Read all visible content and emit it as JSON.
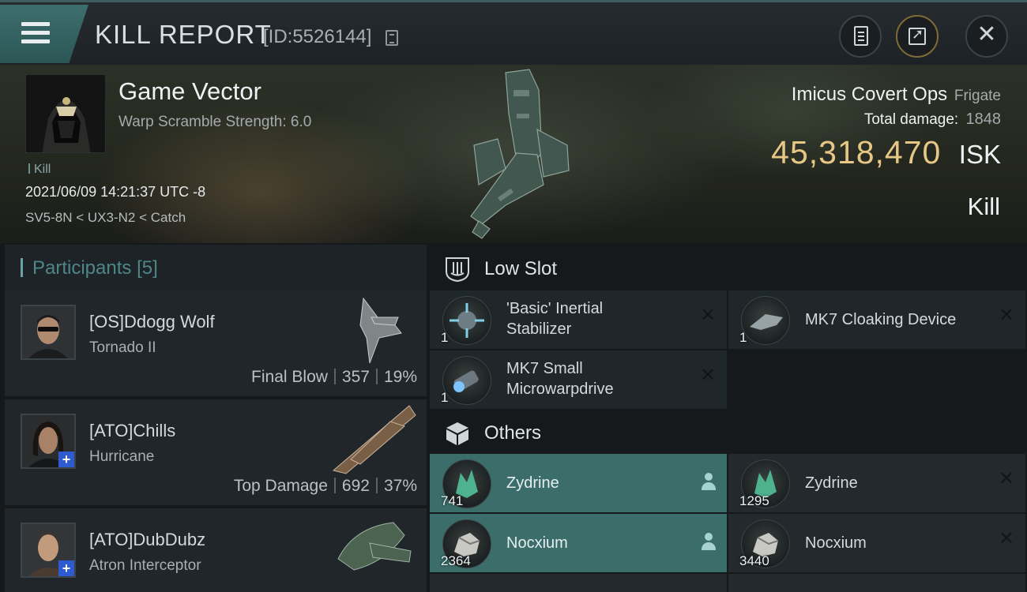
{
  "header": {
    "title": "KILL REPORT",
    "id_text": "[ID:5526144]"
  },
  "victim": {
    "name": "Game Vector",
    "subtitle": "Warp Scramble Strength: 6.0",
    "tag": "Kill",
    "timestamp": "2021/06/09 14:21:37 UTC -8",
    "location": "SV5-8N < UX3-N2 < Catch"
  },
  "ship": {
    "name": "Imicus Covert Ops",
    "class": "Frigate",
    "total_damage_label": "Total damage:",
    "total_damage": "1848",
    "isk_value": "45,318,470",
    "isk_unit": "ISK",
    "result": "Kill"
  },
  "participants": {
    "title": "Participants",
    "count": "[5]",
    "rows": [
      {
        "name": "[OS]Ddogg Wolf",
        "ship": "Tornado II",
        "role": "Final Blow",
        "damage": "357",
        "percent": "19%"
      },
      {
        "name": "[ATO]Chills",
        "ship": "Hurricane",
        "role": "Top Damage",
        "damage": "692",
        "percent": "37%"
      },
      {
        "name": "[ATO]DubDubz",
        "ship": "Atron Interceptor"
      }
    ]
  },
  "sections": {
    "low_slot": "Low Slot",
    "others": "Others"
  },
  "low_slot_items": [
    {
      "name_line1": "'Basic' Inertial",
      "name_line2": "Stabilizer",
      "qty": "1",
      "status_icon": "destroyed-x-icon"
    },
    {
      "name_line1": "MK7 Cloaking Device",
      "name_line2": "",
      "qty": "1",
      "status_icon": "destroyed-x-icon"
    },
    {
      "name_line1": "MK7 Small",
      "name_line2": "Microwarpdrive",
      "qty": "1",
      "status_icon": "destroyed-x-icon"
    }
  ],
  "other_items": [
    {
      "name": "Zydrine",
      "qty": "741",
      "status_icon": "person-icon"
    },
    {
      "name": "Zydrine",
      "qty": "1295",
      "status_icon": "destroyed-x-icon"
    },
    {
      "name": "Nocxium",
      "qty": "2364",
      "status_icon": "person-icon"
    },
    {
      "name": "Nocxium",
      "qty": "3440",
      "status_icon": "destroyed-x-icon"
    }
  ],
  "colors": {
    "accent_teal": "#3d6e6d",
    "isk_gold": "#e6c786",
    "dropped_item_bg": "#3b6e6b"
  }
}
